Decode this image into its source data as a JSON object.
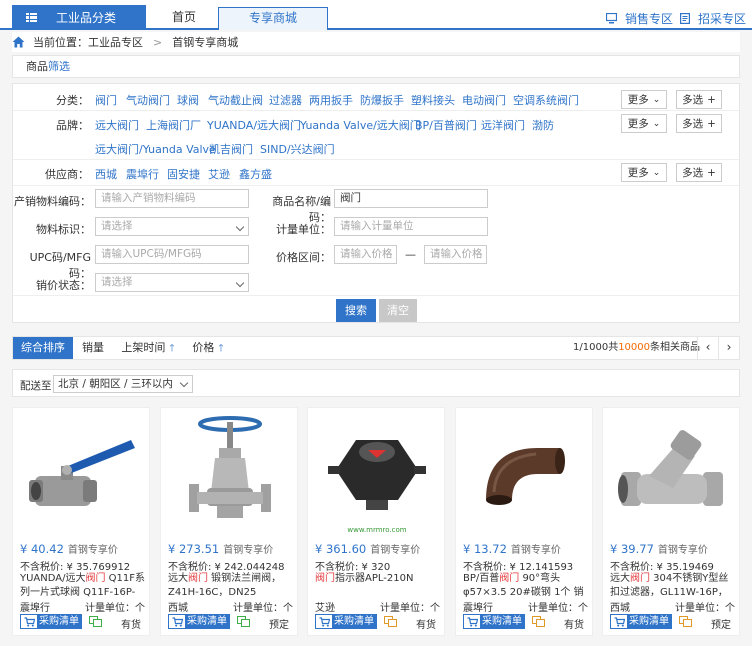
{
  "nav": {
    "category_label": "工业品分类",
    "tabs": [
      "首页",
      "专享商城"
    ],
    "sales_zone": "销售专区",
    "bid_zone": "招采专区"
  },
  "breadcrumb": {
    "prefix": "当前位置：",
    "items": [
      "工业品专区",
      "首钢专享商城"
    ]
  },
  "filter_title": {
    "part1": "商品",
    "part2": "筛选"
  },
  "filters": {
    "category": {
      "label": "分类：",
      "options": [
        "阀门",
        "气动阀门",
        "球阀",
        "气动截止阀",
        "过滤器",
        "两用扳手",
        "防爆扳手",
        "塑料接头",
        "电动阀门",
        "空调系统阀门"
      ]
    },
    "brand": {
      "label": "品牌：",
      "options_row1": [
        "远大阀门",
        "上海阀门厂",
        "YUANDA/远大阀门",
        "Yuanda Valve/远大阀门",
        "BP/百普阀门",
        "远洋阀门",
        "渤防"
      ],
      "options_row2": [
        "远大阀门/Yuanda Valve",
        "凯吉阀门",
        "SIND/兴达阀门"
      ]
    },
    "supplier": {
      "label": "供应商：",
      "options": [
        "西城",
        "震埠行",
        "固安捷",
        "艾逊",
        "鑫方盛"
      ]
    },
    "more_label": "更多",
    "multi_label": "多选"
  },
  "form": {
    "mfg_code": {
      "label": "产销物料编码：",
      "placeholder": "请输入产销物料编码"
    },
    "product_name": {
      "label": "商品名称/编码：",
      "value": "阀门"
    },
    "material_tag": {
      "label": "物料标识：",
      "placeholder": "请选择"
    },
    "unit": {
      "label": "计量单位：",
      "placeholder": "请输入计量单位"
    },
    "upc": {
      "label": "UPC码/MFG码：",
      "placeholder": "请输入UPC码/MFG码"
    },
    "price_range": {
      "label": "价格区间：",
      "min_placeholder": "请输入价格",
      "dash": "—",
      "max_placeholder": "请输入价格"
    },
    "sale_status": {
      "label": "销价状态：",
      "placeholder": "请选择"
    },
    "search_btn": "搜索",
    "clear_btn": "清空"
  },
  "sort": {
    "tabs": [
      "综合排序",
      "销量",
      "上架时间",
      "价格"
    ],
    "page": "1/1000",
    "total_prefix": "共",
    "total": "10000",
    "total_suffix": "条相关商品"
  },
  "delivery": {
    "label": "配送至",
    "value": "北京 / 朝阳区 / 三环以内"
  },
  "products": [
    {
      "price": "¥ 40.42",
      "price_label": "首钢专享价",
      "notax": "不含税价: ¥ 35.769912",
      "name_pre": "YUANDA/远大",
      "name_kw": "阀门",
      "name_post": " Q11F系列一片式球阀 Q11F-16P-DN25",
      "supplier": "震埠行",
      "unit": "计量单位：个",
      "cart": "采购清单",
      "stock": "有货",
      "icon": "ball"
    },
    {
      "price": "¥ 273.51",
      "price_label": "首钢专享价",
      "notax": "不含税价: ¥ 242.044248",
      "name_pre": "远大",
      "name_kw": "阀门",
      "name_post": " 锻钢法兰闸阀，Z41H-16C，DN25",
      "supplier": "西城",
      "unit": "计量单位：个",
      "cart": "采购清单",
      "stock": "预定",
      "icon": "gate"
    },
    {
      "price": "¥ 361.60",
      "price_label": "首钢专享价",
      "notax": "不含税价: ¥ 320",
      "name_pre": "",
      "name_kw": "阀门",
      "name_post": "指示器APL-210N",
      "supplier": "艾逊",
      "unit": "计量单位：个",
      "cart": "采购清单",
      "stock": "有货",
      "icon": "switch",
      "watermark": "www.mrmro.com"
    },
    {
      "price": "¥ 13.72",
      "price_label": "首钢专享价",
      "notax": "不含税价: ¥ 12.141593",
      "name_pre": "BP/百普",
      "name_kw": "阀门",
      "name_post": " 90°弯头 φ57×3.5 20#碳钢 1个 销售单位...",
      "supplier": "震埠行",
      "unit": "计量单位：个",
      "cart": "采购清单",
      "stock": "有货",
      "icon": "elbow"
    },
    {
      "price": "¥ 39.77",
      "price_label": "首钢专享价",
      "notax": "不含税价: ¥ 35.19469",
      "name_pre": "远大",
      "name_kw": "阀门",
      "name_post": " 304不锈钢Y型丝扣过滤器，GL11W-16P，D...",
      "supplier": "西城",
      "unit": "计量单位：个",
      "cart": "采购清单",
      "stock": "预定",
      "icon": "ystrainer"
    }
  ],
  "colors": {
    "accent": "#2f74c9",
    "keyword": "#e4393c",
    "highlight": "#f56a00"
  }
}
